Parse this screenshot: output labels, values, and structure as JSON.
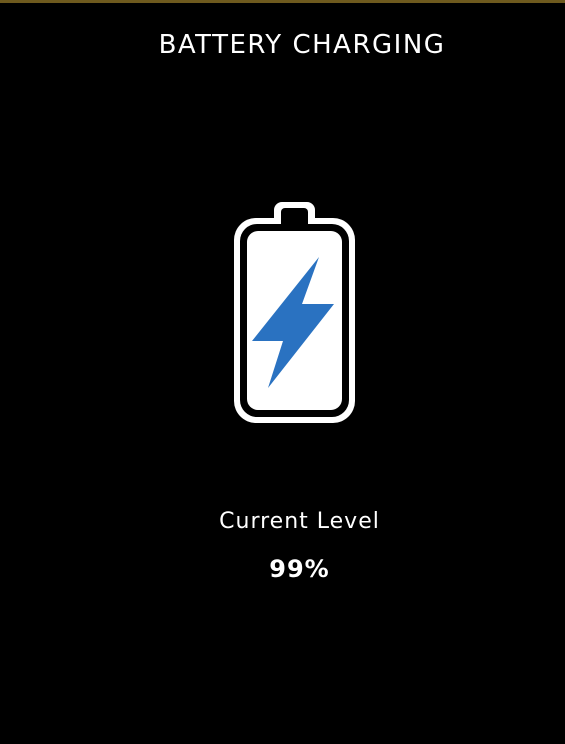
{
  "header": {
    "title": "BATTERY CHARGING"
  },
  "battery": {
    "icon": "battery-charging-icon",
    "bolt_color": "#2a72c1",
    "outline_color": "#ffffff"
  },
  "status": {
    "label": "Current Level",
    "value": "99%"
  }
}
